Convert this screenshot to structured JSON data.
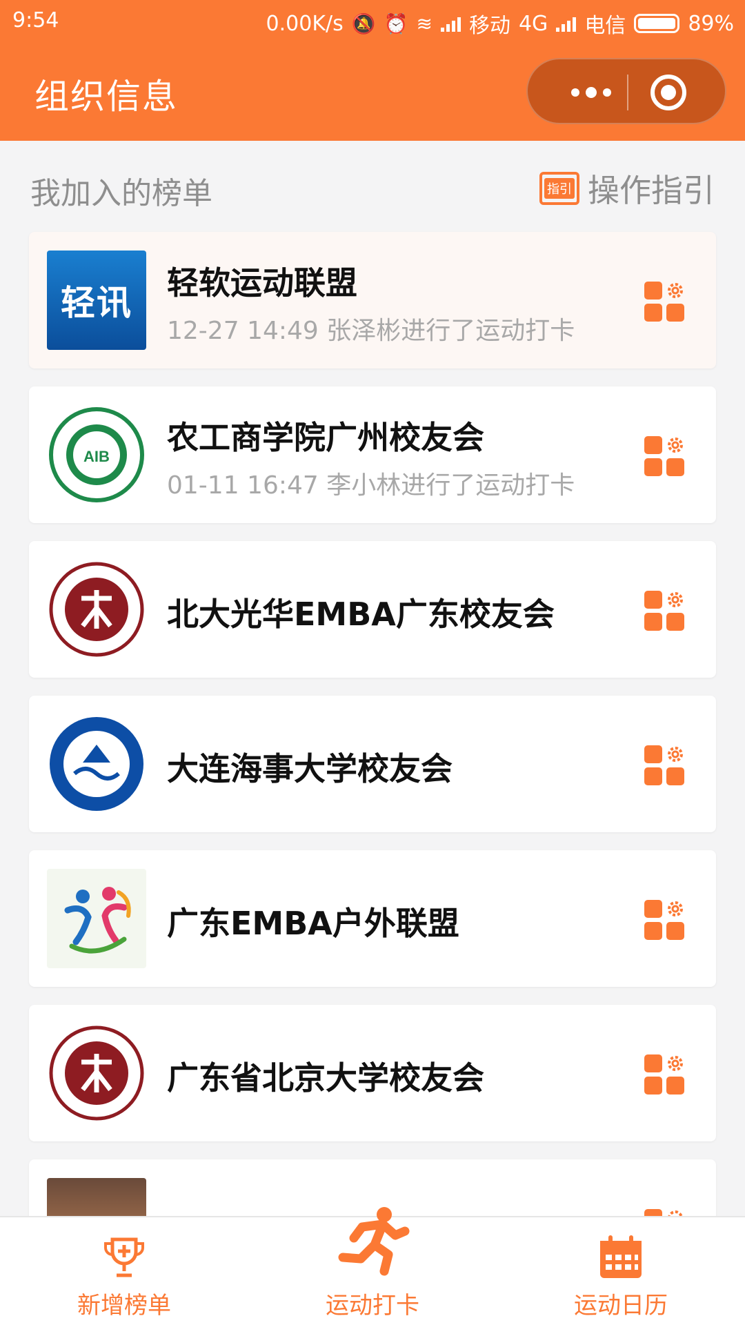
{
  "status_bar": {
    "time": "9:54",
    "speed": "0.00K/s",
    "carrier1": "移动",
    "network": "4G",
    "carrier2": "电信",
    "battery": "89%"
  },
  "header": {
    "title": "组织信息"
  },
  "section": {
    "title": "我加入的榜单",
    "guide_badge": "指引",
    "guide_label": "操作指引"
  },
  "groups": [
    {
      "name": "轻软运动联盟",
      "subtitle": "12-27 14:49 张泽彬进行了运动打卡",
      "logo_text": "轻讯",
      "highlight": true
    },
    {
      "name": "农工商学院广州校友会",
      "subtitle": "01-11 16:47 李小林进行了运动打卡",
      "logo_text": "AIB"
    },
    {
      "name": "北大光华EMBA广东校友会",
      "subtitle": ""
    },
    {
      "name": "大连海事大学校友会",
      "subtitle": ""
    },
    {
      "name": "广东EMBA户外联盟",
      "subtitle": ""
    },
    {
      "name": "广东省北京大学校友会",
      "subtitle": ""
    }
  ],
  "tabbar": [
    {
      "label": "新增榜单",
      "icon": "trophy-plus-icon"
    },
    {
      "label": "运动打卡",
      "icon": "runner-icon"
    },
    {
      "label": "运动日历",
      "icon": "calendar-icon"
    }
  ],
  "colors": {
    "accent": "#fb7934",
    "capsule": "#c8561c",
    "background": "#f4f4f5"
  }
}
